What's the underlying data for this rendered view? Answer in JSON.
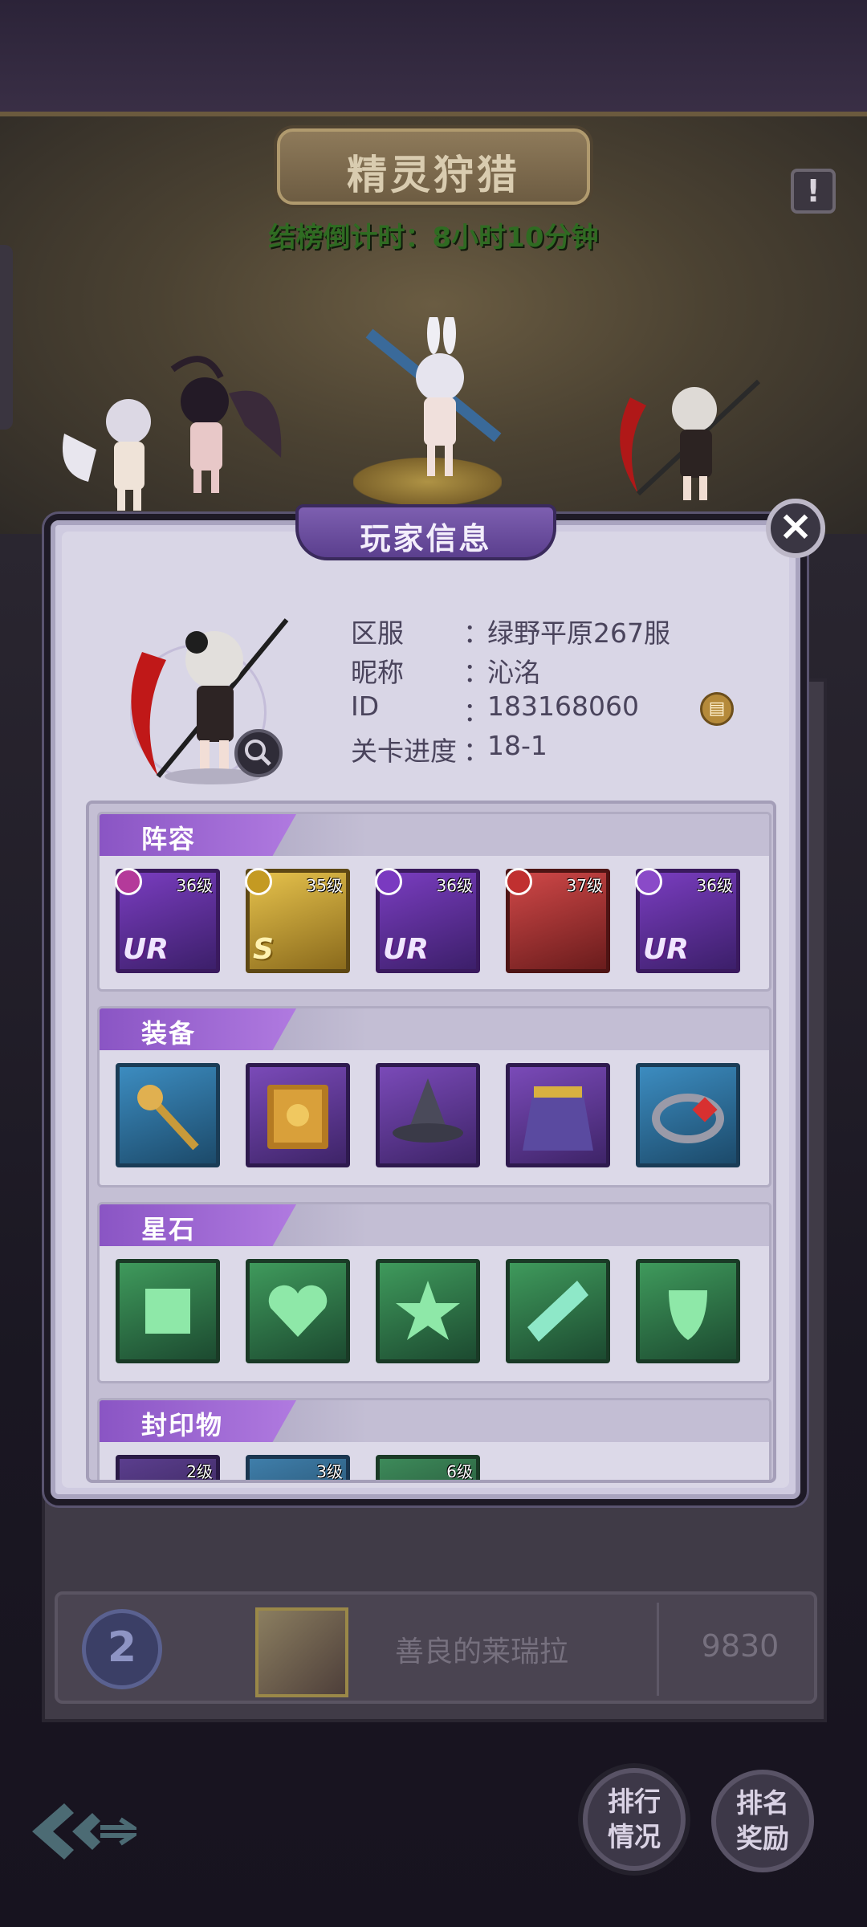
{
  "header": {
    "title": "精灵狩猎",
    "countdown": "结榜倒计时：8小时10分钟"
  },
  "dialog": {
    "title": "玩家信息",
    "info": [
      {
        "label": "区服",
        "colon": "：",
        "value": "绿野平原267服"
      },
      {
        "label": "昵称",
        "colon": "：",
        "value": "沁洺"
      },
      {
        "label": "ID",
        "colon": "：",
        "value": "183168060"
      },
      {
        "label": "关卡进度",
        "colon": "：",
        "value": "18-1"
      }
    ],
    "sections": {
      "lineup": {
        "label": "阵容",
        "heroes": [
          {
            "level": "36级",
            "rarity": "UR"
          },
          {
            "level": "35级",
            "rarity": "S"
          },
          {
            "level": "36级",
            "rarity": "UR"
          },
          {
            "level": "37级",
            "rarity": ""
          },
          {
            "level": "36级",
            "rarity": "UR"
          }
        ]
      },
      "equipment": {
        "label": "装备",
        "items": [
          "scepter-icon",
          "book-icon",
          "witch-hat-icon",
          "cloak-icon",
          "ring-icon"
        ]
      },
      "starstone": {
        "label": "星石",
        "items": [
          "square-gem-icon",
          "heart-gem-icon",
          "star-gem-icon",
          "diamond-gem-icon",
          "shield-gem-icon"
        ]
      },
      "seals": {
        "label": "封印物",
        "items": [
          {
            "level": "2级"
          },
          {
            "level": "3级"
          },
          {
            "level": "6级"
          }
        ]
      }
    }
  },
  "ranking": {
    "rank": "2",
    "name": "善良的莱瑞拉",
    "score": "9830"
  },
  "buttons": {
    "ranking_status": "排行\n情况",
    "ranking_reward": "排名\n奖励"
  },
  "colors": {
    "accent_purple": "#8a55c4",
    "countdown_green": "#2f6b22",
    "panel": "#d9d6e6"
  }
}
